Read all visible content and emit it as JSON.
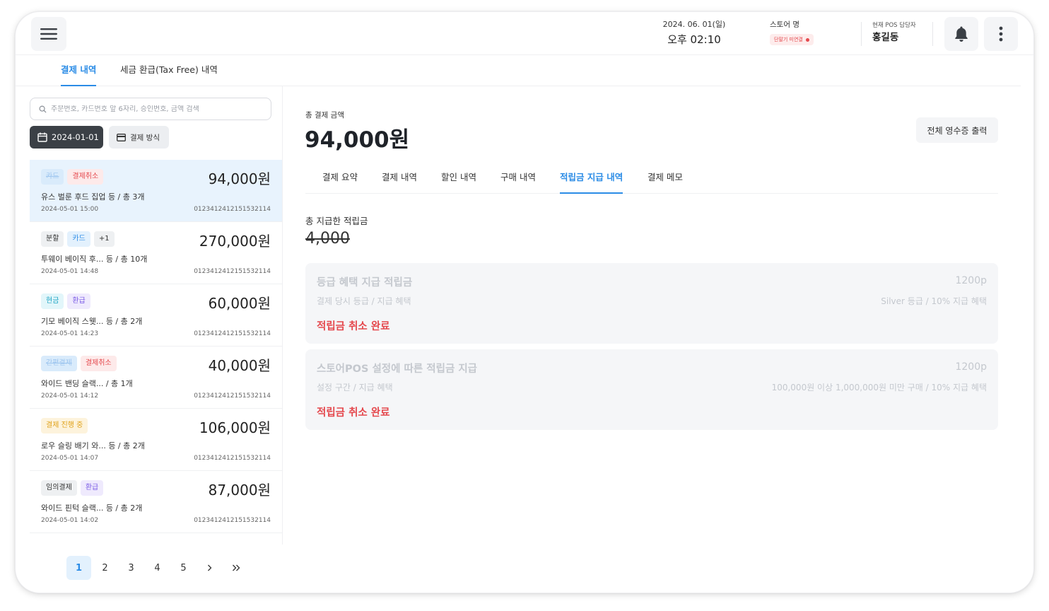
{
  "header": {
    "date": "2024. 06. 01(일)",
    "time": "오후 02:10",
    "store_label": "스토어 명",
    "store_status": "단말기 미연결",
    "staff_label": "현재 POS 담당자",
    "staff_name": "홍길동"
  },
  "top_tabs": [
    {
      "label": "결제 내역",
      "active": true
    },
    {
      "label": "세금 환급(Tax Free) 내역",
      "active": false
    }
  ],
  "search": {
    "placeholder": "주문번호, 카드번호 앞 6자리, 승인번호, 금액 검색"
  },
  "filters": {
    "date": "2024-01-01",
    "payment_method": "결제 방식"
  },
  "transactions": [
    {
      "badges": [
        {
          "text": "카드",
          "style": "blue-dim"
        },
        {
          "text": "결제취소",
          "style": "red"
        }
      ],
      "amount": "94,000원",
      "desc": "유스 벌룬 후드 집업  등  /  총 3개",
      "date": "2024-05-01 15:00",
      "id": "0123412412151532114",
      "selected": true
    },
    {
      "badges": [
        {
          "text": "분할",
          "style": "gray"
        },
        {
          "text": "카드",
          "style": "blue"
        },
        {
          "text": "+1",
          "style": "gray"
        }
      ],
      "amount": "270,000원",
      "desc": "투웨이 베이직 후...  등  /  총 10개",
      "date": "2024-05-01 14:48",
      "id": "0123412412151532114",
      "selected": false
    },
    {
      "badges": [
        {
          "text": "현금",
          "style": "cyan"
        },
        {
          "text": "환급",
          "style": "purple"
        }
      ],
      "amount": "60,000원",
      "desc": "기모 베이직 스웻...  등  /  총 2개",
      "date": "2024-05-01 14:23",
      "id": "0123412412151532114",
      "selected": false
    },
    {
      "badges": [
        {
          "text": "간편결제",
          "style": "blue-dim"
        },
        {
          "text": "결제취소",
          "style": "red"
        }
      ],
      "amount": "40,000원",
      "desc": "와이드 밴딩 슬랙...     /  총 1개",
      "date": "2024-05-01 14:12",
      "id": "0123412412151532114",
      "selected": false
    },
    {
      "badges": [
        {
          "text": "결제 진행 중",
          "style": "yellow"
        }
      ],
      "amount": "106,000원",
      "desc": "로우 슬링 배기 와...  등  /  총 2개",
      "date": "2024-05-01 14:07",
      "id": "0123412412151532114",
      "selected": false
    },
    {
      "badges": [
        {
          "text": "임의결제",
          "style": "gray"
        },
        {
          "text": "환급",
          "style": "purple"
        }
      ],
      "amount": "87,000원",
      "desc": "와이드 핀턱 슬랙...  등  /  총 2개",
      "date": "2024-05-01 14:02",
      "id": "0123412412151532114",
      "selected": false
    }
  ],
  "pagination": {
    "pages": [
      "1",
      "2",
      "3",
      "4",
      "5"
    ],
    "current": "1",
    "next": "›",
    "last": "»"
  },
  "detail": {
    "total_label": "총 결제 금액",
    "total_amount": "94,000원",
    "print_button": "전체 영수증 출력",
    "tabs": [
      {
        "label": "결제 요약",
        "active": false
      },
      {
        "label": "결제 내역",
        "active": false
      },
      {
        "label": "할인 내역",
        "active": false
      },
      {
        "label": "구매 내역",
        "active": false
      },
      {
        "label": "적립금 지급 내역",
        "active": true
      },
      {
        "label": "결제 메모",
        "active": false
      }
    ],
    "points_label": "총 지급한 적립금",
    "points_value": "4,000",
    "cards": [
      {
        "title": "등급 혜택 지급 적립금",
        "point": "1200p",
        "sub_left": "결제 당시 등급 / 지급 혜택",
        "sub_right": "Silver 등급  /  10% 지급 혜택",
        "status": "적립금 취소 완료"
      },
      {
        "title": "스토어POS 설정에 따른 적립금 지급",
        "point": "1200p",
        "sub_left": "설정 구간 / 지급 혜택",
        "sub_right": "100,000원 이상 1,000,000원 미만 구매  /  10% 지급 혜택",
        "status": "적립금 취소 완료"
      }
    ]
  },
  "colors": {
    "accent": "#2b8ce6",
    "danger": "#e5484d",
    "selected_row": "#e8f3fd"
  }
}
